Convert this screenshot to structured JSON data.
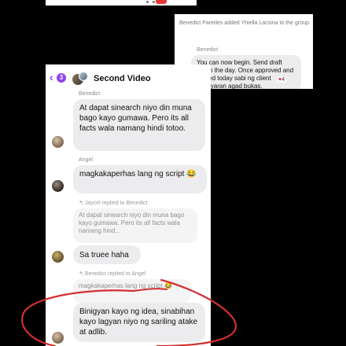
{
  "group_card": {
    "system_note": "Benedict Paredes added Yhiella Lacsina to the group.",
    "sender": "Benedict",
    "message": "You can now begin. Send draft within the day. Once approved and posted today sabi ng client babayaran agad bukas.",
    "reaction_count": "4"
  },
  "chat": {
    "back_badge": "3",
    "title": "Second Video",
    "messages": [
      {
        "sender": "Benedict",
        "text": "At dapat sinearch niyo din muna bago kayo gumawa. Pero its all facts wala namang hindi totoo."
      },
      {
        "sender": "Angel",
        "text": "magkakaperhas lang ng script 😂"
      },
      {
        "reply_note": "Jaycel replied to Benedict",
        "quote": "At dapat sinearch niyo din muna bago kayo gumawa. Pero its all facts wala namang hind...",
        "text": "Sa truee haha"
      },
      {
        "reply_note": "Benedict replied to Angel",
        "quote": "magkakaperhas lang ng script 😂",
        "text": "Binigyan kayo ng idea, sinabihan kayo lagyan niyo ng sariling atake at adlib."
      }
    ]
  },
  "colors": {
    "accent": "#8e44ec",
    "annotation_ink": "#d32f2f",
    "background": "#000000"
  }
}
